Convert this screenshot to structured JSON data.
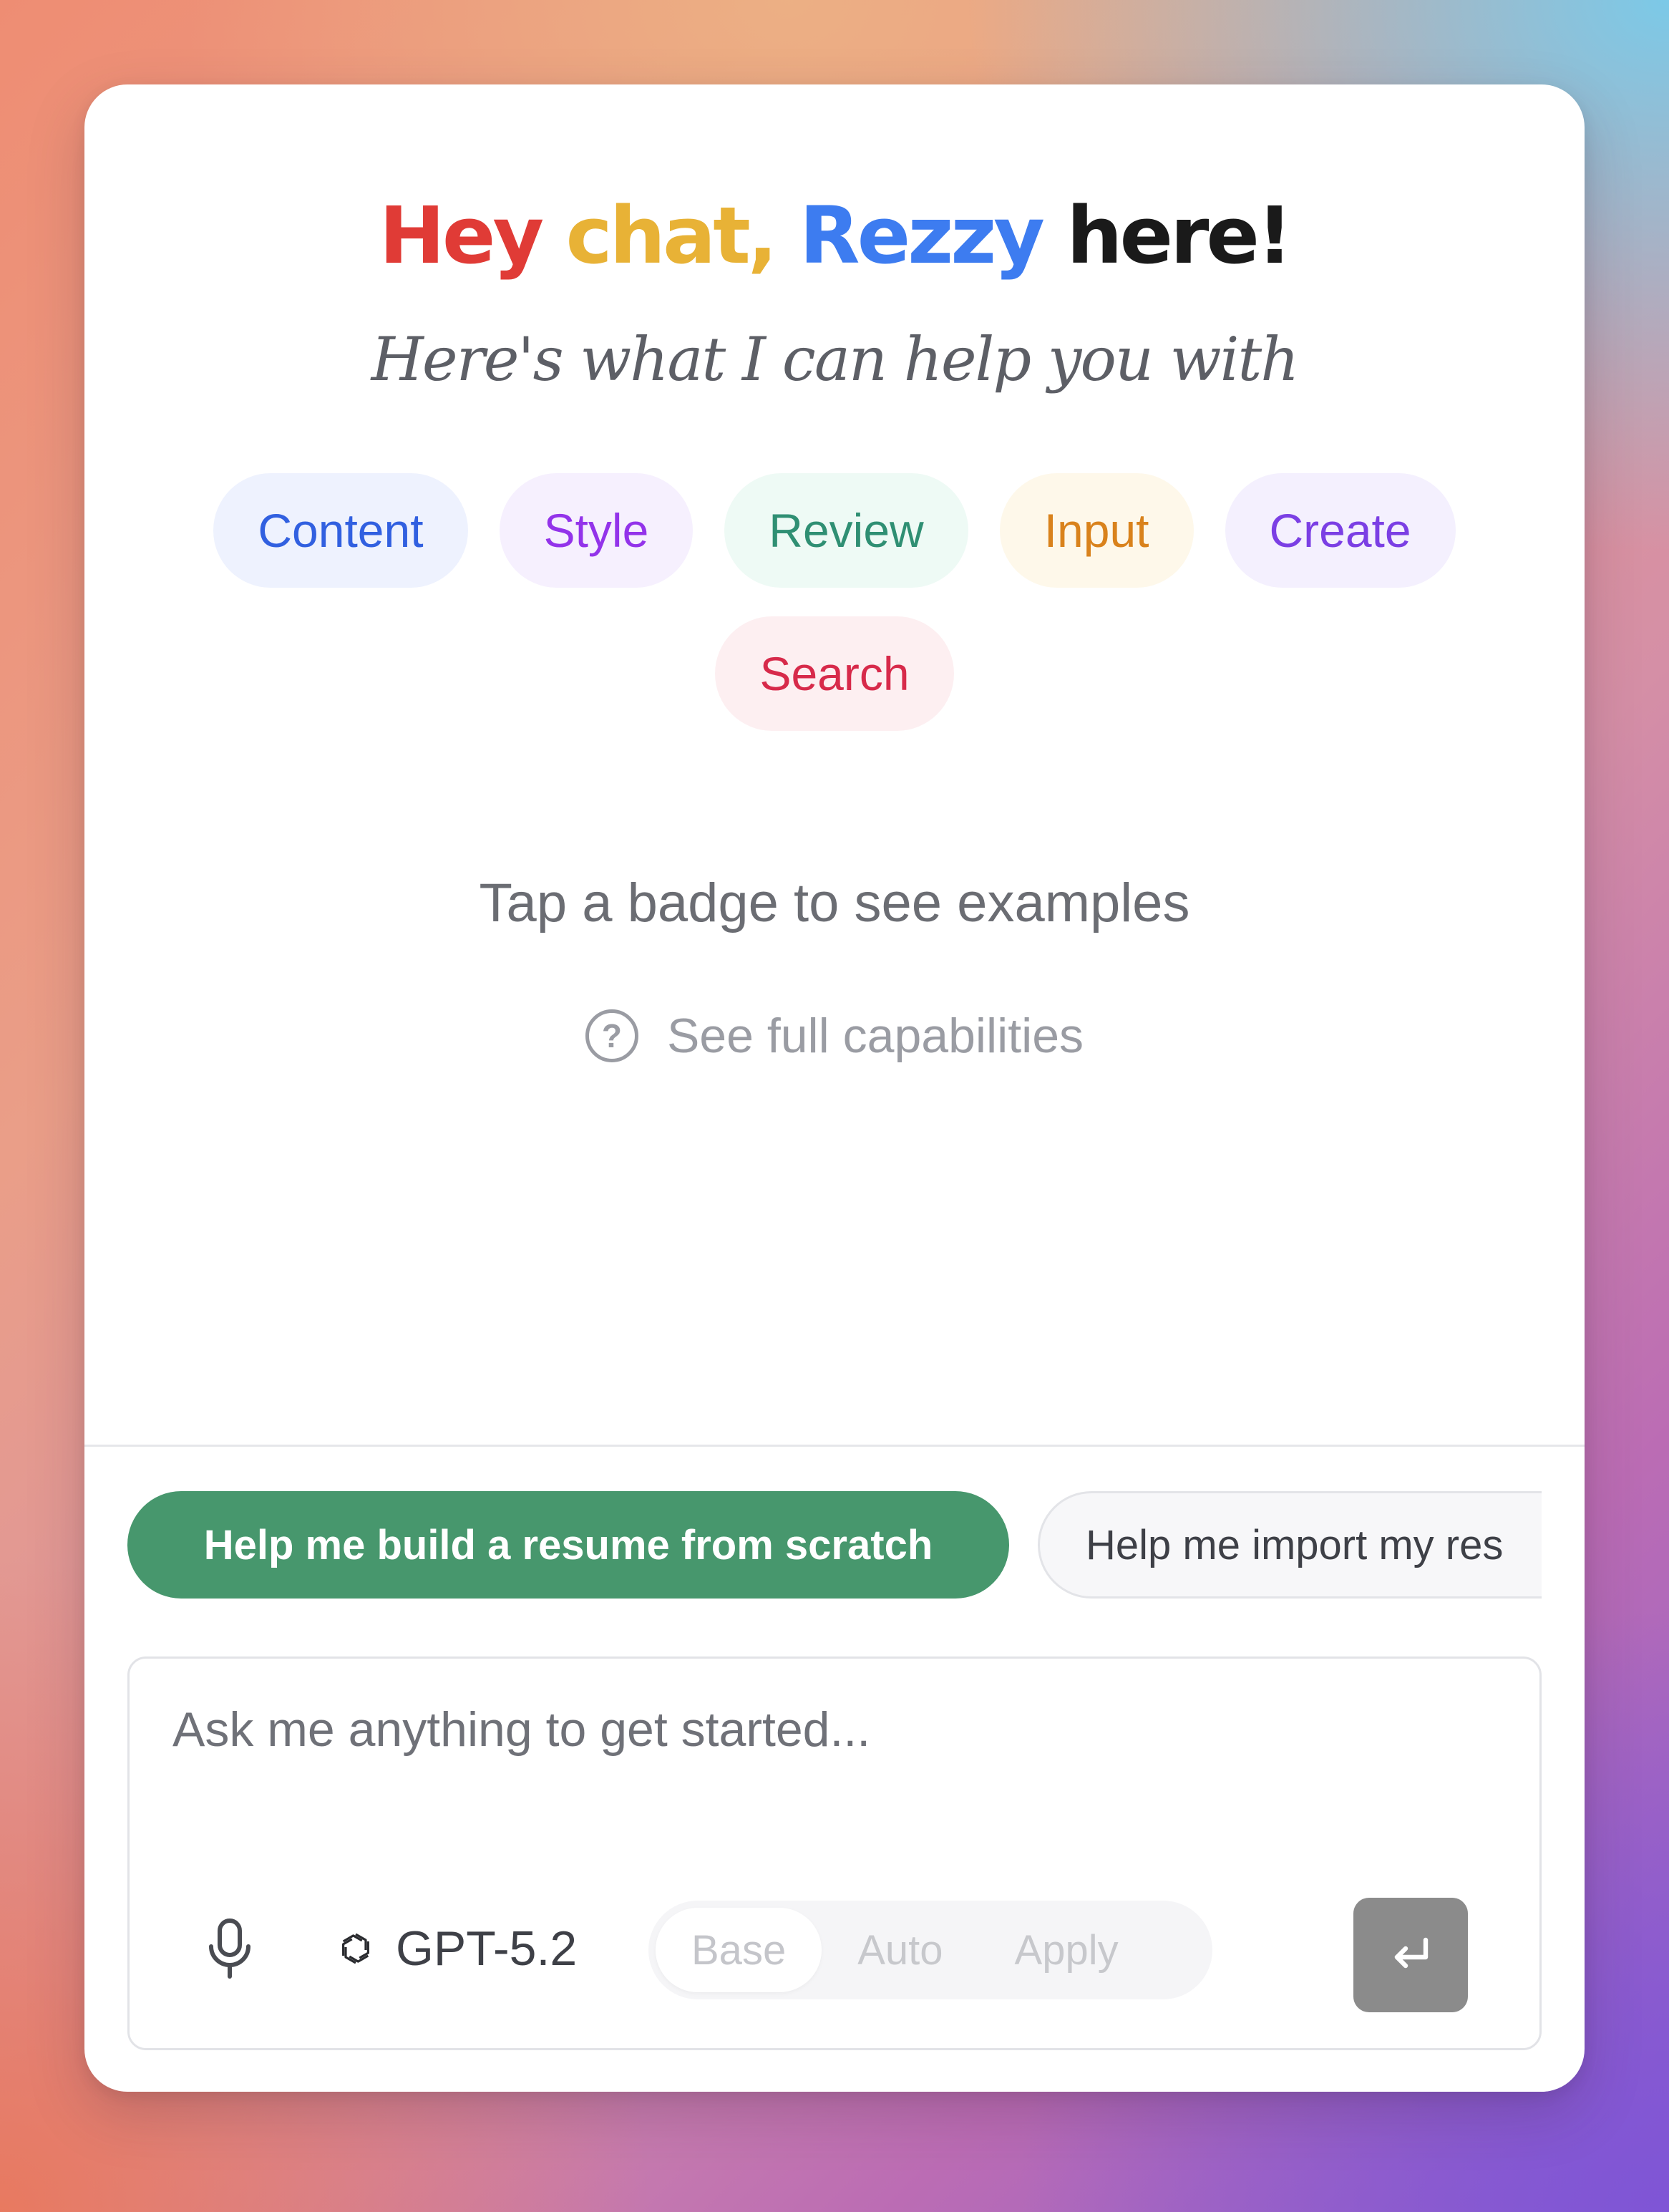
{
  "header": {
    "title_parts": [
      {
        "text": "Hey",
        "color": "#e03b36"
      },
      {
        "text": "chat,",
        "color": "#e8b236"
      },
      {
        "text": "Rezzy",
        "color": "#3d7cf0"
      },
      {
        "text": "here!",
        "color": "#1a1a1a"
      }
    ],
    "subtitle": "Here's what I can help you with"
  },
  "badges": [
    {
      "label": "Content",
      "text_color": "#3160e0",
      "bg_color": "#eef2fe"
    },
    {
      "label": "Style",
      "text_color": "#9333ea",
      "bg_color": "#f6f0fe"
    },
    {
      "label": "Review",
      "text_color": "#2f8f73",
      "bg_color": "#eefaf5"
    },
    {
      "label": "Input",
      "text_color": "#d9821c",
      "bg_color": "#fef8ea"
    },
    {
      "label": "Create",
      "text_color": "#7b3fe4",
      "bg_color": "#f4f0fe"
    },
    {
      "label": "Search",
      "text_color": "#d72a4a",
      "bg_color": "#fdeff1"
    }
  ],
  "hint": "Tap a badge to see examples",
  "capabilities_link": {
    "icon": "help-circle-icon",
    "label": "See full capabilities"
  },
  "suggestions": [
    {
      "label": "Help me build a resume from scratch",
      "style": "primary"
    },
    {
      "label": "Help me import my res",
      "style": "secondary"
    }
  ],
  "composer": {
    "placeholder": "Ask me anything to get started...",
    "value": "",
    "mic_icon": "microphone-icon",
    "model": {
      "icon": "openai-logo-icon",
      "label": "GPT-5.2"
    },
    "modes": [
      "Base",
      "Auto",
      "Apply"
    ],
    "selected_mode": "Base",
    "send_icon": "enter-return-icon"
  },
  "colors": {
    "primary_chip": "#47976d",
    "send_button": "#8b8b8b"
  }
}
